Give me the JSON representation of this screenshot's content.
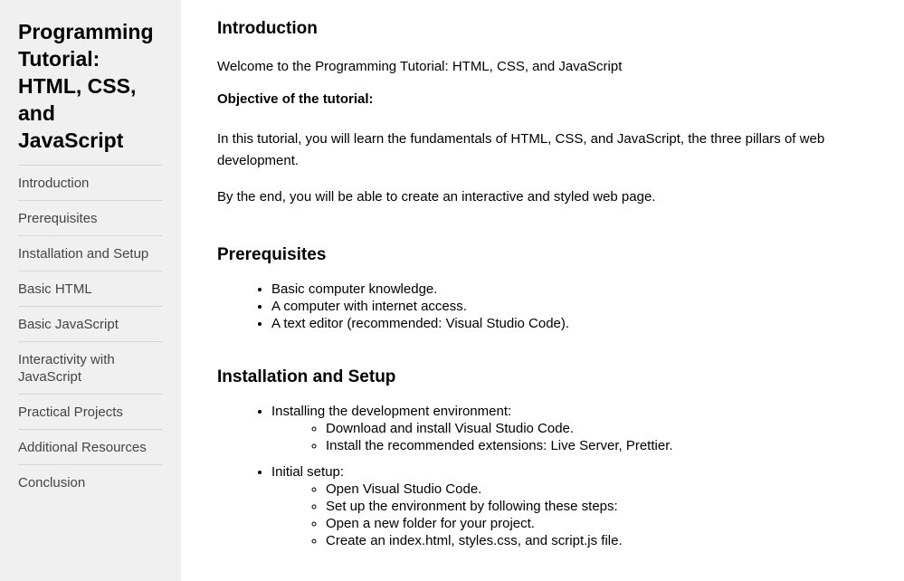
{
  "sidebar": {
    "title": "Programming Tutorial: HTML, CSS, and JavaScript",
    "items": [
      {
        "label": "Introduction"
      },
      {
        "label": "Prerequisites"
      },
      {
        "label": "Installation and Setup"
      },
      {
        "label": "Basic HTML"
      },
      {
        "label": "Basic JavaScript"
      },
      {
        "label": "Interactivity with JavaScript"
      },
      {
        "label": "Practical Projects"
      },
      {
        "label": "Additional Resources"
      },
      {
        "label": "Conclusion"
      }
    ]
  },
  "introduction": {
    "title": "Introduction",
    "welcome": "Welcome to the Programming Tutorial: HTML, CSS, and JavaScript",
    "objective_label": "Objective of the tutorial:",
    "objective_text": "In this tutorial, you will learn the fundamentals of HTML, CSS, and JavaScript, the three pillars of web development.",
    "outcome": "By the end, you will be able to create an interactive and styled web page."
  },
  "prerequisites": {
    "title": "Prerequisites",
    "items": [
      "Basic computer knowledge.",
      "A computer with internet access.",
      "A text editor (recommended: Visual Studio Code)."
    ]
  },
  "installation": {
    "title": "Installation and Setup",
    "groups": [
      {
        "label": "Installing the development environment:",
        "items": [
          "Download and install Visual Studio Code.",
          "Install the recommended extensions: Live Server, Prettier."
        ]
      },
      {
        "label": "Initial setup:",
        "items": [
          "Open Visual Studio Code.",
          "Set up the environment by following these steps:",
          "Open a new folder for your project.",
          "Create an index.html, styles.css, and script.js file."
        ]
      }
    ]
  }
}
